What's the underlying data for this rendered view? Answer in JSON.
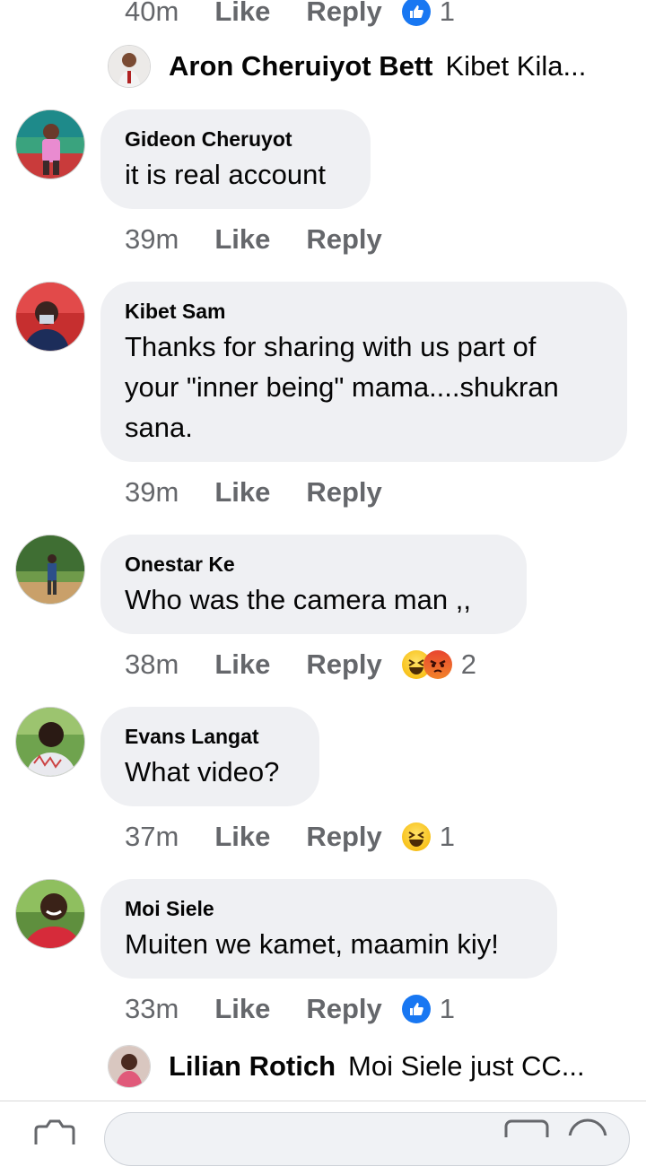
{
  "top_meta": {
    "time": "40m",
    "like": "Like",
    "reply": "Reply",
    "reaction_icon": "like-icon",
    "reaction_count": "1"
  },
  "top_reply_preview": {
    "name": "Aron Cheruiyot Bett",
    "text": "Kibet Kila..."
  },
  "comments": [
    {
      "name": "Gideon Cheruyot",
      "text": "it is real account",
      "time": "39m",
      "like": "Like",
      "reply": "Reply",
      "reaction_count": ""
    },
    {
      "name": "Kibet Sam",
      "text_lines": [
        "Thanks for sharing with us part of",
        "your \"inner being\"  mama....shukran",
        "sana."
      ],
      "time": "39m",
      "like": "Like",
      "reply": "Reply",
      "reaction_count": ""
    },
    {
      "name": "Onestar Ke",
      "text": "Who was the camera man ,,",
      "time": "38m",
      "like": "Like",
      "reply": "Reply",
      "reaction_icons": [
        "haha-icon",
        "angry-icon"
      ],
      "reaction_count": "2"
    },
    {
      "name": "Evans Langat",
      "text": "What video?",
      "time": "37m",
      "like": "Like",
      "reply": "Reply",
      "reaction_icons": [
        "haha-icon"
      ],
      "reaction_count": "1"
    },
    {
      "name": "Moi Siele",
      "text": "Muiten we kamet, maamin kiy!",
      "time": "33m",
      "like": "Like",
      "reply": "Reply",
      "reaction_icons": [
        "like-icon"
      ],
      "reaction_count": "1"
    }
  ],
  "bottom_reply_preview": {
    "name": "Lilian Rotich",
    "text": "Moi Siele just CC..."
  },
  "colors": {
    "bubble": "#eff0f3",
    "meta_text": "#65676b",
    "like_blue": "#1877f2",
    "text": "#050505"
  }
}
